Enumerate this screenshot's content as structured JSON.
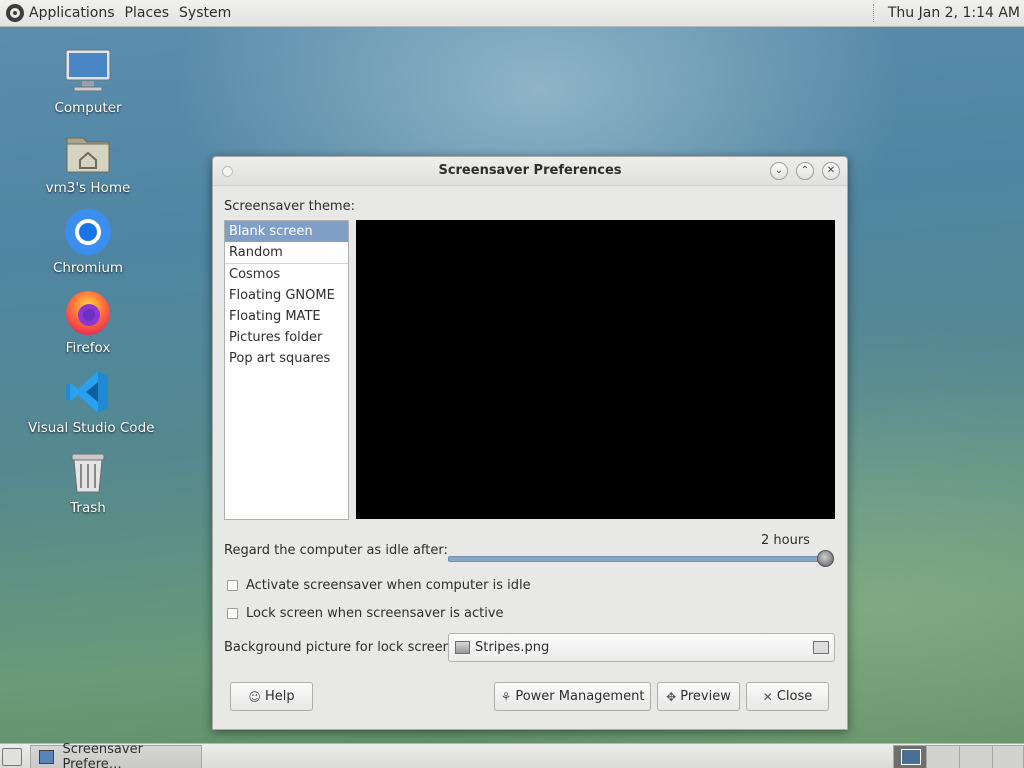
{
  "top_panel": {
    "menus": [
      "Applications",
      "Places",
      "System"
    ],
    "clock": "Thu Jan  2,  1:14 AM"
  },
  "desktop": {
    "icons": [
      {
        "label": "Computer",
        "icon": "computer-icon"
      },
      {
        "label": "vm3's Home",
        "icon": "home-folder-icon"
      },
      {
        "label": "Chromium",
        "icon": "chromium-icon"
      },
      {
        "label": "Firefox",
        "icon": "firefox-icon"
      },
      {
        "label": "Visual Studio Code",
        "icon": "vscode-icon"
      },
      {
        "label": "Trash",
        "icon": "trash-icon"
      }
    ]
  },
  "window": {
    "title": "Screensaver Preferences",
    "theme_label": "Screensaver theme:",
    "themes": [
      "Blank screen",
      "Random",
      "Cosmos",
      "Floating GNOME",
      "Floating MATE",
      "Pictures folder",
      "Pop art squares"
    ],
    "selected_theme": "Blank screen",
    "idle_label": "Regard the computer as idle after:",
    "idle_value": "2 hours",
    "idle_fraction": 1.0,
    "activate_label": "Activate screensaver when computer is idle",
    "activate_checked": false,
    "lock_label": "Lock screen when screensaver is active",
    "lock_checked": false,
    "bg_label": "Background picture for lock screen:",
    "bg_file": "Stripes.png",
    "buttons": {
      "help": "Help",
      "power": "Power Management",
      "preview": "Preview",
      "close": "Close"
    }
  },
  "bottom_panel": {
    "task_label": "Screensaver Prefere…"
  },
  "colors": {
    "selection": "#7f9fc7",
    "slider": "#8aa6c6"
  }
}
